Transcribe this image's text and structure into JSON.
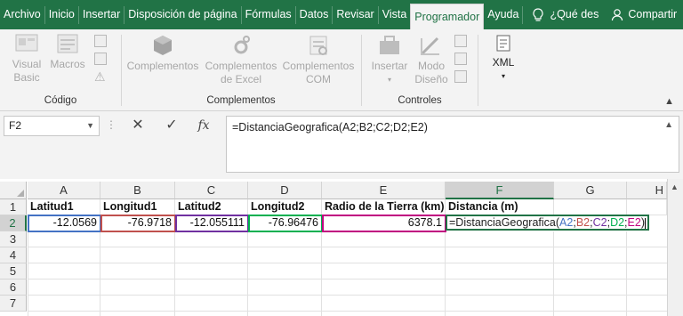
{
  "menu": {
    "items": [
      "Archivo",
      "Inicio",
      "Insertar",
      "Disposición de página",
      "Fórmulas",
      "Datos",
      "Revisar",
      "Vista",
      "Programador",
      "Ayuda"
    ],
    "active": "Programador",
    "tell_me": "¿Qué des",
    "share": "Compartir"
  },
  "ribbon": {
    "codigo": {
      "title": "Código",
      "visual_basic": "Visual Basic",
      "macros": "Macros"
    },
    "complementos": {
      "title": "Complementos",
      "complementos": "Complementos",
      "excel": "Complementos de Excel",
      "com": "Complementos COM"
    },
    "controles": {
      "title": "Controles",
      "insertar": "Insertar",
      "modo_diseno": "Modo Diseño"
    },
    "xml": {
      "label": "XML"
    }
  },
  "formula_bar": {
    "namebox": "F2",
    "formula": "=DistanciaGeografica(A2;B2;C2;D2;E2)"
  },
  "grid": {
    "columns": [
      "A",
      "B",
      "C",
      "D",
      "E",
      "F",
      "G",
      "H"
    ],
    "rows": [
      "1",
      "2",
      "3",
      "4",
      "5",
      "6",
      "7"
    ],
    "headers": [
      "Latitud1",
      "Longitud1",
      "Latitud2",
      "Longitud2",
      "Radio de la Tierra (km)",
      "Distancia (m)"
    ],
    "row2": [
      "-12.0569",
      "-76.9718",
      "-12.055111",
      "-76.96476",
      "6378.1"
    ],
    "editing": {
      "prefix": "=DistanciaGeografica(",
      "r1": "A2",
      "s1": ";",
      "r2": "B2",
      "s2": ";",
      "r3": "C2",
      "s3": ";",
      "r4": "D2",
      "s4": ";",
      "r5": "E2",
      "suffix": ")"
    }
  },
  "colors": {
    "excel_green": "#217346",
    "ref_a": "#4472c4",
    "ref_b": "#c0504d",
    "ref_c": "#7030a0",
    "ref_d": "#00b050",
    "ref_e": "#c00080"
  }
}
